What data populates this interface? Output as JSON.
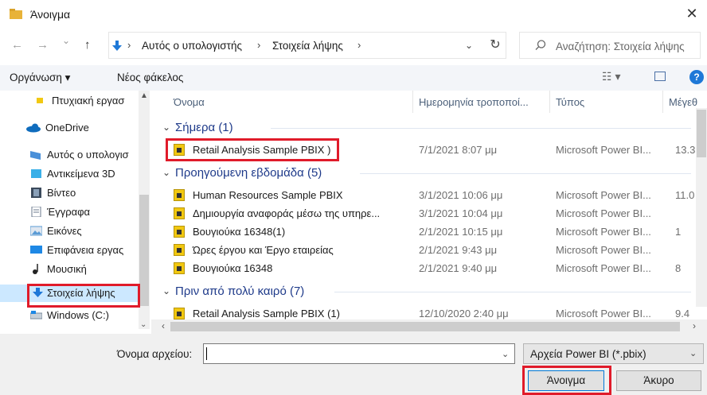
{
  "window": {
    "title": "Άνοιγμα",
    "close_glyph": "✕"
  },
  "nav": {
    "back_glyph": "←",
    "forward_glyph": "→",
    "recent_glyph": "⌄",
    "up_glyph": "↑"
  },
  "address": {
    "crumbs": [
      "Αυτός ο υπολογιστής",
      "Στοιχεία λήψης"
    ],
    "sep": "›",
    "refresh_glyph": "↻",
    "dropdown_glyph": "⌄"
  },
  "search": {
    "placeholder": "Αναζήτηση: Στοιχεία λήψης",
    "icon": "search-icon"
  },
  "commandbar": {
    "organize": "Οργάνωση ▾",
    "new_folder": "Νέος φάκελος",
    "view_glyph": "☷ ▾",
    "help_glyph": "?"
  },
  "sidebar": {
    "items": [
      {
        "label": "Πτυχιακή εργασ",
        "icon": "folder-icon",
        "color": "#f2c811"
      },
      {
        "label": "OneDrive",
        "icon": "cloud-icon",
        "color": "#0f6cbd"
      },
      {
        "label": "Αυτός ο υπολογισ",
        "icon": "computer-icon",
        "color": "#4a90d9"
      },
      {
        "label": "Αντικείμενα 3D",
        "icon": "cube-icon",
        "color": "#3ab0e8"
      },
      {
        "label": "Βίντεο",
        "icon": "film-icon",
        "color": "#3b4a5c"
      },
      {
        "label": "Έγγραφα",
        "icon": "document-icon",
        "color": "#6b7a8c"
      },
      {
        "label": "Εικόνες",
        "icon": "pictures-icon",
        "color": "#5a9bd5"
      },
      {
        "label": "Επιφάνεια εργας",
        "icon": "desktop-icon",
        "color": "#1e88e5"
      },
      {
        "label": "Μουσική",
        "icon": "music-icon",
        "color": "#222"
      },
      {
        "label": "Στοιχεία λήψης",
        "icon": "download-icon",
        "color": "#1e78d7"
      },
      {
        "label": "Windows (C:)",
        "icon": "drive-icon",
        "color": "#7a8a9c"
      }
    ],
    "scroll_up": "▲",
    "scroll_down": "⌄"
  },
  "columns": {
    "name": "Όνομα",
    "date": "Ημερομηνία τροποποί...",
    "type": "Τύπος",
    "size": "Μέγεθ"
  },
  "groups": [
    {
      "title": "Σήμερα (1)",
      "chevron": "⌄"
    },
    {
      "title": "Προηγούμενη εβδομάδα (5)",
      "chevron": "⌄"
    },
    {
      "title": "Πριν από πολύ καιρό (7)",
      "chevron": "⌄"
    }
  ],
  "files": [
    {
      "name": "Retail Analysis Sample PBIX",
      "suffix": ")",
      "date": "7/1/2021 8:07 μμ",
      "type": "Microsoft Power BI...",
      "size": "13.3"
    },
    {
      "name": "Human Resources Sample PBIX",
      "date": "3/1/2021 10:06 μμ",
      "type": "Microsoft Power BI...",
      "size": "11.0"
    },
    {
      "name": "Δημιουργία αναφοράς μέσω της υπηρε...",
      "date": "3/1/2021 10:04 μμ",
      "type": "Microsoft Power BI...",
      "size": ""
    },
    {
      "name": "Βουγιούκα 16348(1)",
      "date": "2/1/2021 10:15 μμ",
      "type": "Microsoft Power BI...",
      "size": "1"
    },
    {
      "name": "Ώρες έργου και Έργο εταιρείας",
      "date": "2/1/2021 9:43 μμ",
      "type": "Microsoft Power BI...",
      "size": ""
    },
    {
      "name": "Βουγιούκα 16348",
      "date": "2/1/2021 9:40 μμ",
      "type": "Microsoft Power BI...",
      "size": "8"
    },
    {
      "name": "Retail Analysis Sample PBIX (1)",
      "date": "12/10/2020 2:40 μμ",
      "type": "Microsoft Power BI...",
      "size": "9.4"
    }
  ],
  "hscroll": {
    "left": "‹",
    "right": "›"
  },
  "footer": {
    "filename_label": "Όνομα αρχείου:",
    "filename_value": "",
    "filename_dd": "⌄",
    "filetype": "Αρχεία Power BI (*.pbix)",
    "filetype_dd": "⌄",
    "open_label": "Άνοιγμα",
    "cancel_label": "Άκυρο"
  },
  "colors": {
    "highlight": "#e01b2a",
    "accent": "#0078d7",
    "group_text": "#1e3a8a"
  }
}
